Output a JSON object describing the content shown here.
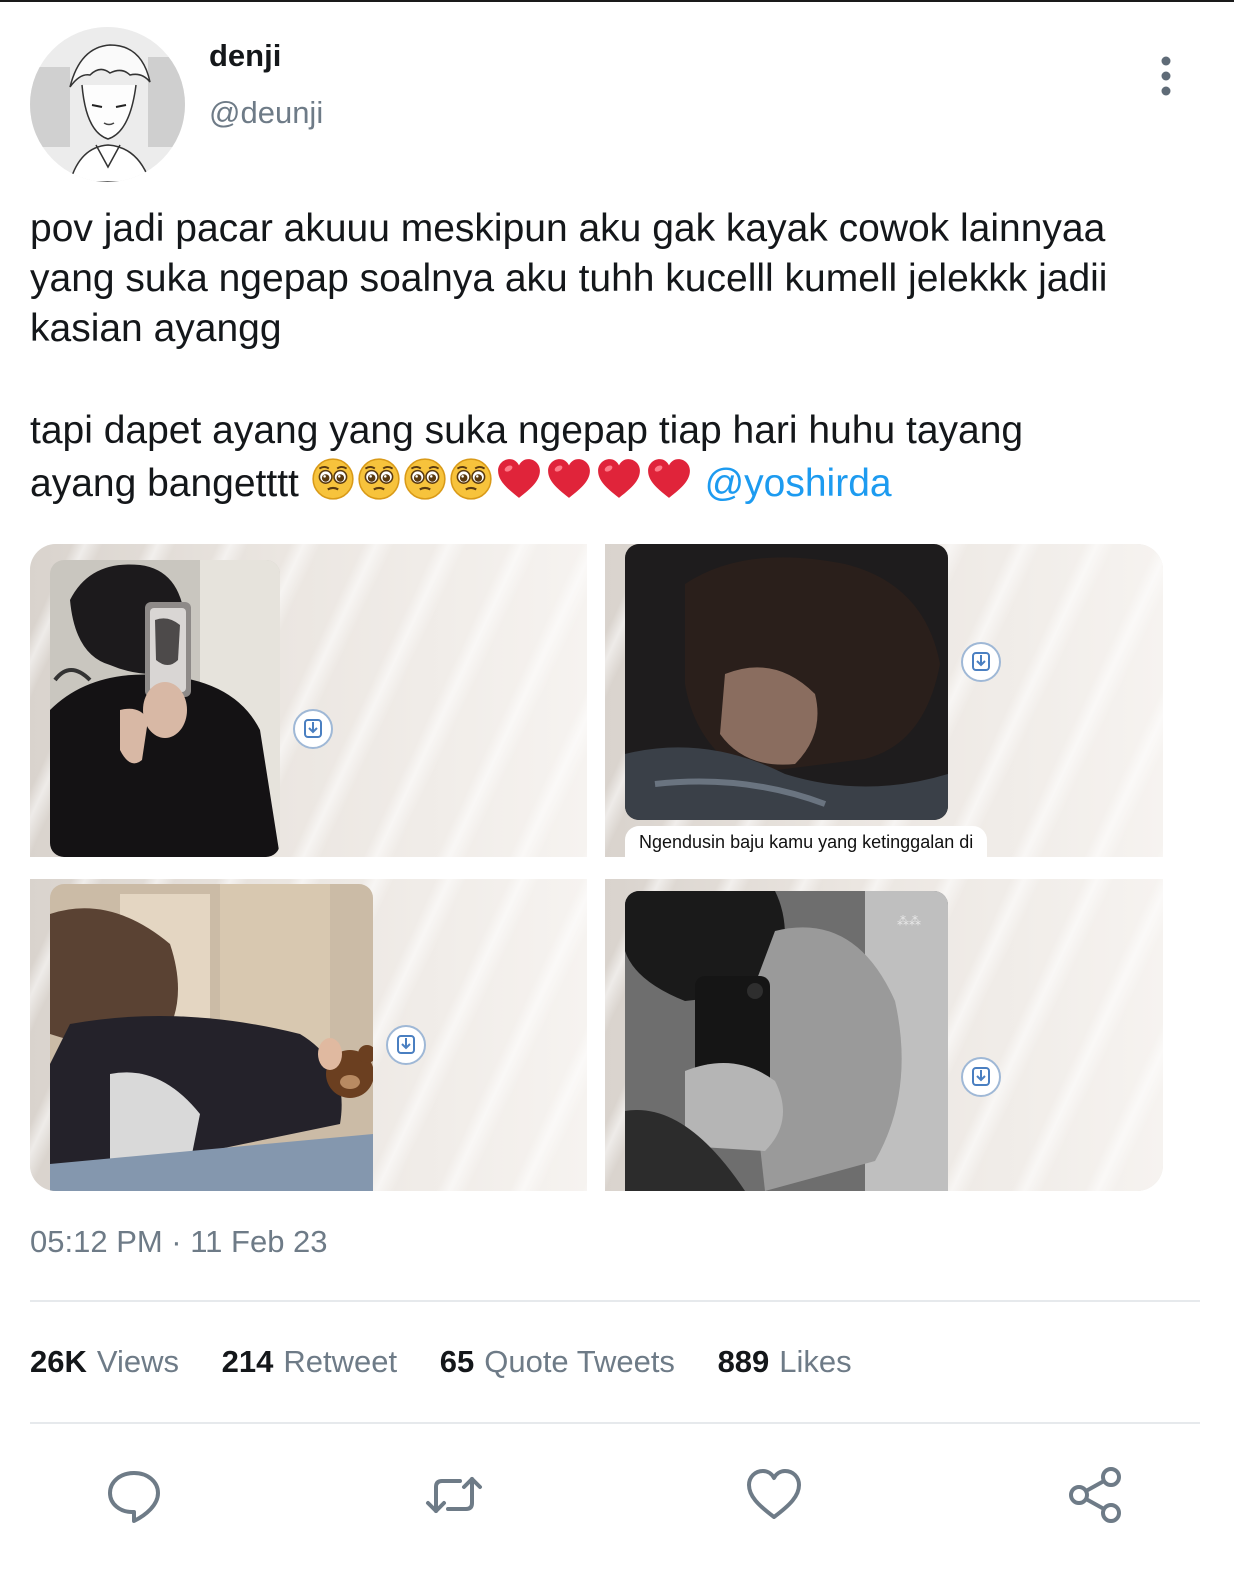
{
  "user": {
    "display_name": "denji",
    "handle": "@deunji"
  },
  "tweet": {
    "line1": "pov jadi pacar akuuu meskipun aku gak kayak cowok lainnyaa",
    "line2": "yang suka ngepap soalnya aku tuhh kucelll kumell jelekkk jadii",
    "line3": "kasian ayangg",
    "line4": "tapi dapet ayang yang suka ngepap tiap hari huhu tayang",
    "line5_text": "ayang bangetttt",
    "mention": "@yoshirda",
    "emojis": [
      "pleading-face",
      "pleading-face",
      "pleading-face",
      "pleading-face",
      "red-heart",
      "red-heart",
      "red-heart",
      "red-heart"
    ]
  },
  "media": {
    "caption": "Ngendusin baju kamu yang ketinggalan di"
  },
  "meta": {
    "timestamp": "05:12 PM · 11 Feb 23"
  },
  "stats": [
    {
      "value": "26K",
      "label": "Views"
    },
    {
      "value": "214",
      "label": "Retweet"
    },
    {
      "value": "65",
      "label": "Quote Tweets"
    },
    {
      "value": "889",
      "label": "Likes"
    }
  ],
  "actions": [
    "reply-icon",
    "retweet-icon",
    "like-icon",
    "share-icon"
  ],
  "colors": {
    "mention": "#1d9bf0",
    "secondary_text": "#6e7b87",
    "icon": "#6e7b87"
  }
}
